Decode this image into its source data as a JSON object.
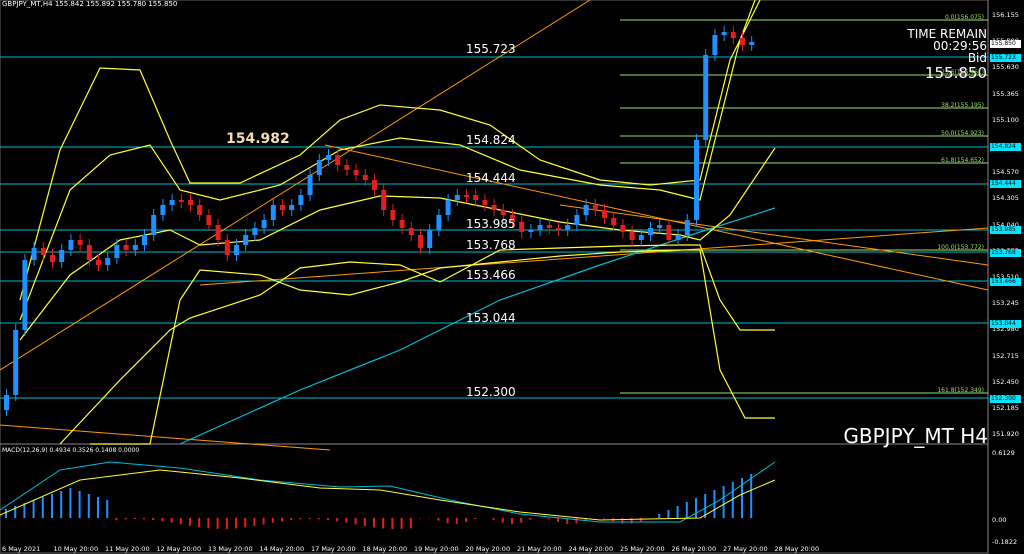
{
  "symbol_header": "GBPJPY_MT,H4  155.842 155.892 155.780 155.850",
  "macd_header": "MACD(12,26,9)  0.4934 0.3526 0.1408 0.0000",
  "time_remain_label": "TIME REMAIN",
  "time_remain_value": "00:29:56",
  "bid_label": "Bid",
  "bid_value": "155.850",
  "symbol_title": "GBPJPY_MT H4",
  "level_labels": [
    "155.723",
    "154.982",
    "154.824",
    "154.444",
    "153.985",
    "153.768",
    "153.466",
    "153.044",
    "152.300"
  ],
  "price_axis": [
    "156.155",
    "155.890",
    "155.630",
    "155.365",
    "155.100",
    "154.835",
    "154.570",
    "154.305",
    "154.040",
    "153.775",
    "153.510",
    "153.245",
    "152.980",
    "152.715",
    "152.450",
    "152.185",
    "151.920"
  ],
  "price_boxes": [
    "155.850",
    "155.723",
    "154.824",
    "154.444",
    "153.985",
    "153.768",
    "153.466",
    "153.044",
    "152.300"
  ],
  "macd_axis": [
    "0.6129",
    "0.00",
    "-0.1822"
  ],
  "time_axis": [
    "6 May 2021",
    "10 May 20:00",
    "11 May 20:00",
    "12 May 20:00",
    "13 May 20:00",
    "14 May 20:00",
    "17 May 20:00",
    "18 May 20:00",
    "19 May 20:00",
    "20 May 20:00",
    "21 May 20:00",
    "24 May 20:00",
    "25 May 20:00",
    "26 May 20:00",
    "27 May 20:00",
    "28 May 20:00"
  ],
  "fib_labels": [
    "0.0(156.075)",
    "23.6(155.461)",
    "38.2(155.195)",
    "50.0(154.923)",
    "61.8(154.652)",
    "100.0(153.772)",
    "161.8(152.349)"
  ],
  "colors": {
    "bull": "#1e90ff",
    "bear": "#e02020",
    "bands": "#ffff33",
    "ma": "#00bcd4",
    "trend": "#ff9900",
    "fib": "#9be36a",
    "level": "#00bcd4"
  }
}
